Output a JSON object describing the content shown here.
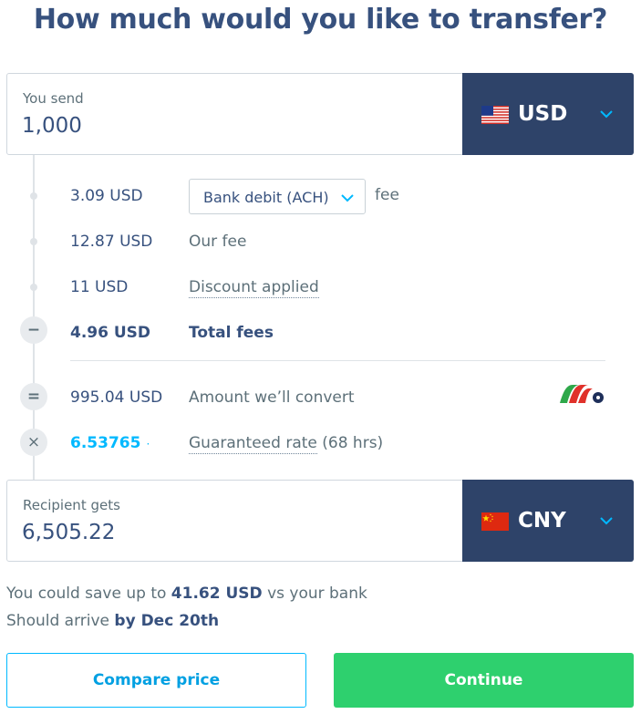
{
  "heading": "How much would you like to transfer?",
  "send": {
    "label": "You send",
    "value": "1,000",
    "currency": "USD",
    "flag": "us-flag-icon"
  },
  "fees": {
    "payment_fee_amount": "3.09 USD",
    "payment_method": "Bank debit (ACH)",
    "payment_fee_label": "fee",
    "our_fee_amount": "12.87 USD",
    "our_fee_label": "Our fee",
    "discount_amount": "11 USD",
    "discount_label": "Discount applied",
    "total_amount": "4.96 USD",
    "total_label": "Total fees"
  },
  "convert": {
    "amount": "995.04 USD",
    "label": "Amount we’ll convert",
    "rate": "6.53765",
    "rate_label": "Guaranteed rate",
    "rate_duration": "(68 hrs)"
  },
  "receive": {
    "label": "Recipient gets",
    "value": "6,505.22",
    "currency": "CNY",
    "flag": "cn-flag-icon"
  },
  "savings": {
    "prefix": "You could save up to",
    "amount": "41.62 USD",
    "suffix": "vs your bank"
  },
  "arrival": {
    "prefix": "Should arrive",
    "date": "by Dec 20th"
  },
  "buttons": {
    "compare": "Compare price",
    "continue": "Continue"
  },
  "symbols": {
    "minus": "−",
    "equals": "=",
    "times": "×"
  },
  "colors": {
    "navy": "#2e4369",
    "text": "#37517e",
    "accent_blue": "#00b9ff",
    "green": "#2ed06e"
  }
}
